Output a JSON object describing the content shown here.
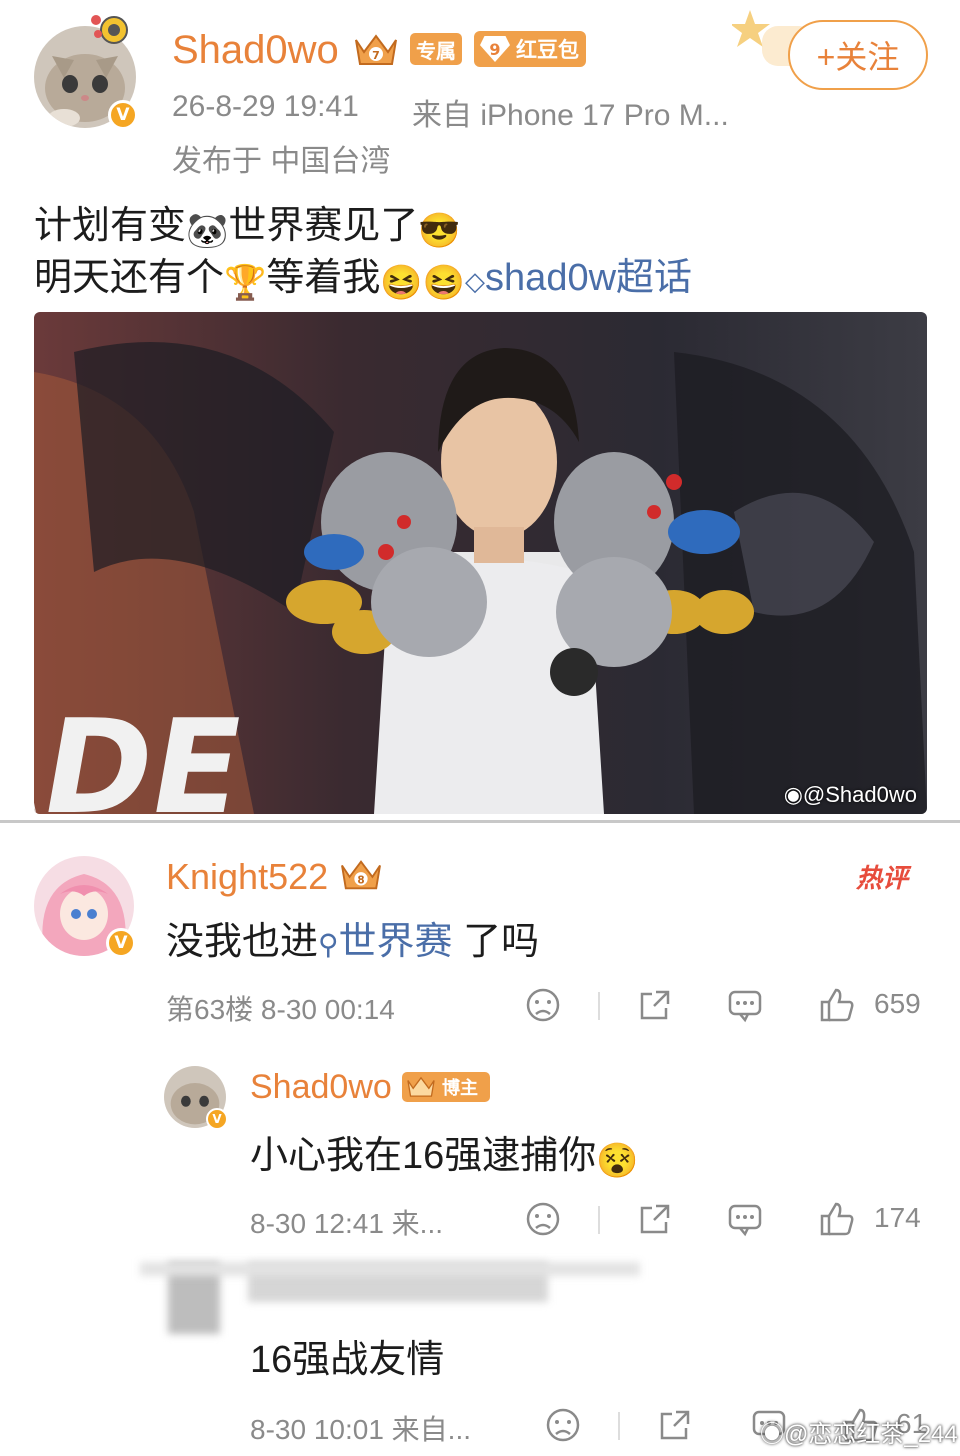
{
  "post": {
    "username": "Shad0wo",
    "tag_exclusive": "专属",
    "tag_redpacket_level": "9",
    "tag_redpacket": "红豆包",
    "follow_label": "+关注",
    "timestamp": "26-8-29 19:41",
    "source": "来自 iPhone 17 Pro M...",
    "location": "发布于 中国台湾",
    "line1_a": "计划有变",
    "line1_b": "世界赛见了",
    "line2_a": "明天还有个",
    "line2_b": "等着我",
    "topic": "shad0w超话",
    "photo_watermark": "@Shad0wo"
  },
  "comments": [
    {
      "username": "Knight522",
      "crown_level": "8",
      "hot_label": "热评",
      "text_a": "没我也进",
      "search_topic": "世界赛",
      "text_b": " 了吗",
      "floor_time": "第63楼  8-30 00:14",
      "likes": "659"
    },
    {
      "username": "Shad0wo",
      "role_tag": "博主",
      "text": "小心我在16强逮捕你",
      "time": "8-30 12:41  来...",
      "likes": "174"
    },
    {
      "text": "16强战友情",
      "time": "8-30 10:01  来自...",
      "likes": "61"
    }
  ],
  "overlay_watermark": "@恋恋红茶_244",
  "colors": {
    "username": "#e8823a",
    "topic_link": "#4a6ea8",
    "meta_gray": "#8a8a8a",
    "hot": "#e74c3c",
    "badge_orange": "#f5a623"
  }
}
